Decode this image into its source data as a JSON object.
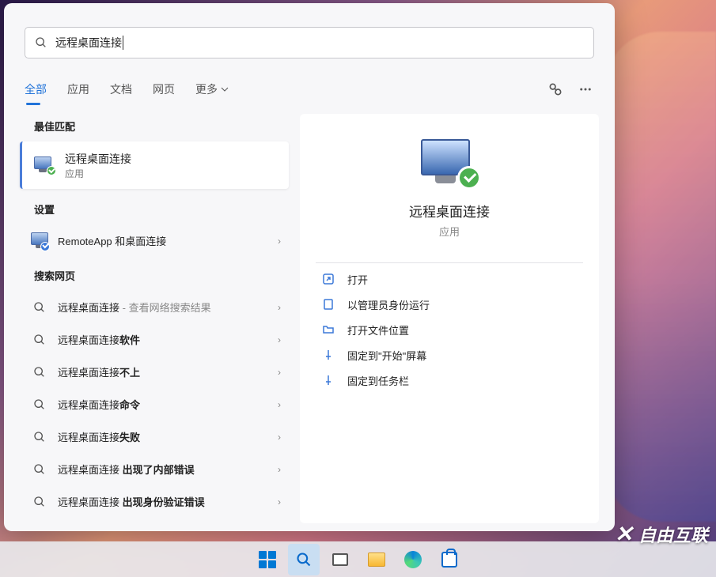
{
  "search": {
    "query": "远程桌面连接"
  },
  "tabs": {
    "all": "全部",
    "apps": "应用",
    "docs": "文档",
    "web": "网页",
    "more": "更多"
  },
  "sections": {
    "best_match": "最佳匹配",
    "settings": "设置",
    "search_web": "搜索网页"
  },
  "best": {
    "title": "远程桌面连接",
    "type": "应用"
  },
  "settings_results": [
    {
      "label": "RemoteApp 和桌面连接"
    }
  ],
  "web_results": [
    {
      "prefix": "远程桌面连接",
      "suffix": " - 查看网络搜索结果"
    },
    {
      "prefix": "远程桌面连接",
      "suffix": "软件"
    },
    {
      "prefix": "远程桌面连接",
      "suffix": "不上"
    },
    {
      "prefix": "远程桌面连接",
      "suffix": "命令"
    },
    {
      "prefix": "远程桌面连接",
      "suffix": "失败"
    },
    {
      "prefix": "远程桌面连接 ",
      "suffix": "出现了内部错误"
    },
    {
      "prefix": "远程桌面连接 ",
      "suffix": "出现身份验证错误"
    }
  ],
  "preview": {
    "title": "远程桌面连接",
    "type": "应用",
    "actions": {
      "open": "打开",
      "run_admin": "以管理员身份运行",
      "open_location": "打开文件位置",
      "pin_start": "固定到\"开始\"屏幕",
      "pin_taskbar": "固定到任务栏"
    }
  },
  "watermark": "自由互联"
}
